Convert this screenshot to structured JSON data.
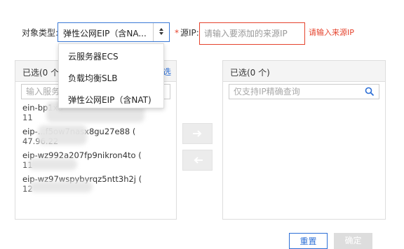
{
  "filter": {
    "type_label": "对象类型:",
    "type_selected": "弹性公网EIP（含NA...",
    "source_label": "源IP:",
    "source_required_mark": "*",
    "source_placeholder": "请输入要添加的来源IP",
    "source_error": "请输入来源IP"
  },
  "dropdown": {
    "options": [
      "云服务器ECS",
      "负载均衡SLB",
      "弹性公网EIP（含NAT)"
    ]
  },
  "left_panel": {
    "title": "已选(0 个)",
    "select_all": "选",
    "search_placeholder": "输入服务",
    "items": [
      {
        "id": "ein-bp1x8",
        "ip": "11"
      },
      {
        "id": "eip-...f5ow7nasx8gu27e88 (",
        "ip": "47.96.22"
      },
      {
        "id": "eip-wz992a207fp9nikron4to (",
        "ip": "11"
      },
      {
        "id": "eip-wz97wspybyrqz5ntt3h2j (",
        "ip": "12"
      }
    ]
  },
  "right_panel": {
    "title": "已选(0 个)",
    "search_placeholder": "仅支持IP精确查询"
  },
  "actions": {
    "move_right_icon": "arrow-right-icon",
    "move_left_icon": "arrow-left-icon"
  },
  "footer": {
    "confirm_label": "重置",
    "ok_label": "确定"
  },
  "colors": {
    "accent": "#2d6fd6",
    "error": "#e5432d",
    "disabled": "#dddddd"
  }
}
